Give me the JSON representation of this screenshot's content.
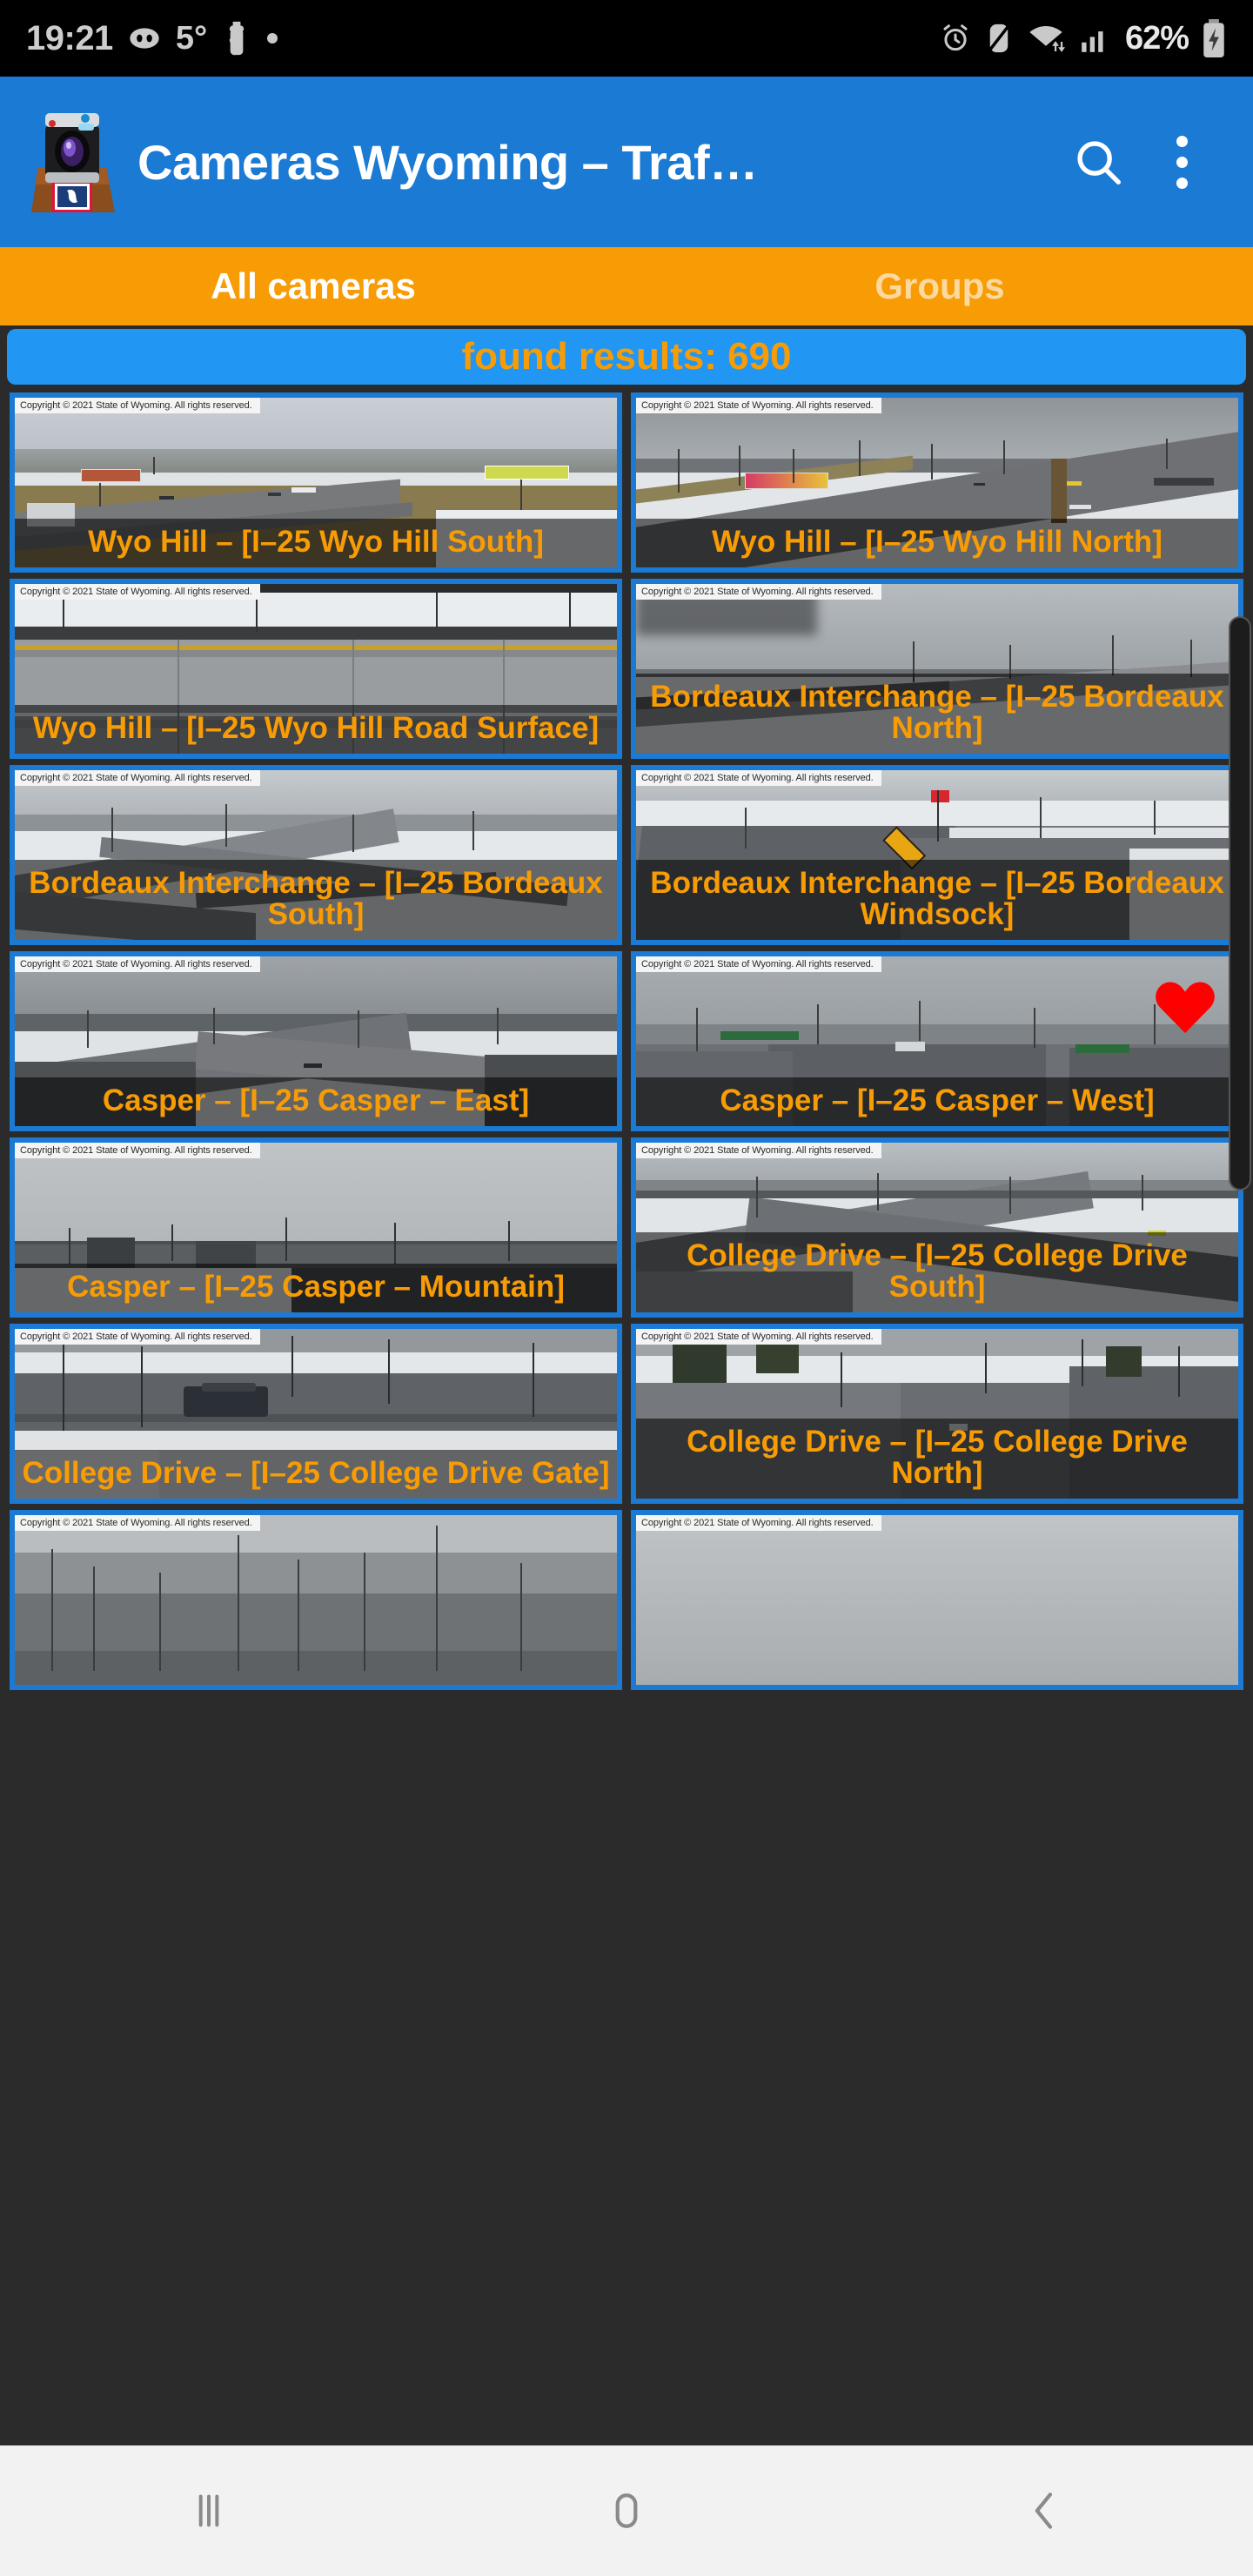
{
  "status_bar": {
    "time": "19:21",
    "temperature": "5°",
    "battery": "62%",
    "left_icons": [
      "discord-icon",
      "puzzle-icon",
      "dot-icon"
    ],
    "right_icons": [
      "alarm-icon",
      "mute-icon",
      "wifi-icon",
      "signal-icon",
      "battery-charging-icon"
    ]
  },
  "app_bar": {
    "icon": "camera-wyoming-app-icon",
    "title": "Cameras Wyoming – Traf…",
    "search_icon": "search-icon",
    "overflow_icon": "overflow-menu-icon"
  },
  "tabs": {
    "items": [
      {
        "label": "All cameras",
        "active": true
      },
      {
        "label": "Groups",
        "active": false
      }
    ]
  },
  "results_banner": {
    "text": "found results: 690",
    "background": "#2196F3",
    "text_color": "#F89C06"
  },
  "theme": {
    "accent_orange": "#F89C06",
    "accent_blue": "#1a7ad4",
    "banner_blue": "#2196F3",
    "page_bg": "#2b2b2b",
    "favorite_red": "#FF0000"
  },
  "watermark": "Copyright © 2021 State of Wyoming.  All rights reserved.",
  "cameras": [
    {
      "label": "Wyo Hill – [I–25 Wyo Hill South]",
      "favorite": false,
      "scene": "wyo-hill-south"
    },
    {
      "label": "Wyo Hill – [I–25 Wyo Hill North]",
      "favorite": false,
      "scene": "wyo-hill-north"
    },
    {
      "label": "Wyo Hill – [I–25 Wyo Hill Road Surface]",
      "favorite": false,
      "scene": "wyo-hill-road-surface"
    },
    {
      "label": "Bordeaux Interchange – [I–25 Bordeaux North]",
      "favorite": false,
      "scene": "bordeaux-north"
    },
    {
      "label": "Bordeaux Interchange – [I–25 Bordeaux South]",
      "favorite": false,
      "scene": "bordeaux-south"
    },
    {
      "label": "Bordeaux Interchange – [I–25 Bordeaux Windsock]",
      "favorite": false,
      "scene": "bordeaux-windsock"
    },
    {
      "label": "Casper – [I–25 Casper – East]",
      "favorite": false,
      "scene": "casper-east"
    },
    {
      "label": "Casper – [I–25 Casper – West]",
      "favorite": true,
      "scene": "casper-west"
    },
    {
      "label": "Casper – [I–25 Casper – Mountain]",
      "favorite": false,
      "scene": "casper-mountain"
    },
    {
      "label": "College Drive – [I–25 College Drive South]",
      "favorite": false,
      "scene": "college-south"
    },
    {
      "label": "College Drive – [I–25 College Drive Gate]",
      "favorite": false,
      "scene": "college-gate"
    },
    {
      "label": "College Drive – [I–25 College Drive North]",
      "favorite": false,
      "scene": "college-north"
    },
    {
      "label": "",
      "favorite": false,
      "scene": "partial-left"
    },
    {
      "label": "",
      "favorite": false,
      "scene": "partial-right"
    }
  ],
  "nav_bar": {
    "buttons": [
      {
        "name": "recents-button",
        "icon": "recents-icon"
      },
      {
        "name": "home-button",
        "icon": "home-icon"
      },
      {
        "name": "back-button",
        "icon": "back-icon"
      }
    ]
  }
}
